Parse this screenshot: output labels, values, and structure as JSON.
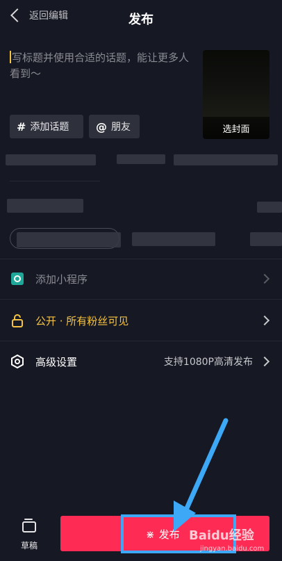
{
  "header": {
    "back_label": "返回编辑",
    "title": "发布"
  },
  "caption": {
    "placeholder": "写标题并使用合适的话题，能让更多人看到～"
  },
  "cover": {
    "label": "选封面"
  },
  "chips": [
    {
      "symbol": "#",
      "label": "添加话题"
    },
    {
      "symbol": "@",
      "label": "朋友"
    }
  ],
  "rows": {
    "mini_program": {
      "label": "添加小程序",
      "icon": "mini-program-icon"
    },
    "visibility": {
      "label": "公开 · 所有粉丝可见",
      "color": "#f6c343",
      "icon": "unlock-icon"
    },
    "advanced": {
      "label": "高级设置",
      "right_text": "支持1080P高清发布",
      "icon": "hexagon-settings-icon"
    }
  },
  "bottom": {
    "draft_label": "草稿",
    "publish_label": "发布"
  },
  "watermark": {
    "brand": "Baidu经验",
    "url": "jingyan.baidu.com"
  },
  "colors": {
    "background": "#161823",
    "publish": "#fe2c55",
    "highlight": "#3da8f5",
    "accent": "#f6c343"
  }
}
